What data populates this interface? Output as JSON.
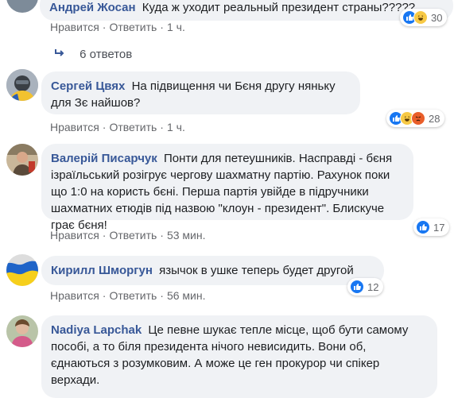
{
  "comments": [
    {
      "author": "Андрей Жосан",
      "text": "Куда ж уходит реальный президент страны?????",
      "like_label": "Нравится",
      "reply_label": "Ответить",
      "time": "1 ч.",
      "reaction_count": "30",
      "reactions": [
        "like-icon",
        "haha-icon"
      ]
    },
    {
      "author": "Сергей Цвях",
      "text": "На підвищення чи Бєня другу няньку для Зє найшов?",
      "like_label": "Нравится",
      "reply_label": "Ответить",
      "time": "1 ч.",
      "reaction_count": "28",
      "reactions": [
        "like-icon",
        "haha-icon",
        "angry-icon"
      ]
    },
    {
      "author": "Валерій Писарчук",
      "text": "Понти для петеушників. Насправді - бєня ізраїльський розігрує чергову шахматну партію. Рахунок поки що 1:0 на користь бєні. Перша партія увійде в підручники шахматних етюдів під назвою \"клоун - президент\". Блискуче грає бєня!",
      "like_label": "Нравится",
      "reply_label": "Ответить",
      "time": "53 мин.",
      "reaction_count": "17",
      "reactions": [
        "like-icon"
      ]
    },
    {
      "author": "Кирилл Шморгун",
      "text": "язычок в ушке теперь будет другой",
      "like_label": "Нравится",
      "reply_label": "Ответить",
      "time": "56 мин.",
      "reaction_count": "12",
      "reactions": [
        "like-icon"
      ]
    },
    {
      "author": "Nadiya Lapchak",
      "text": "Це певне шукає тепле місце, щоб бути самому пособі, а то біля президента нічого невисидить. Вони об, єднаються з розумковим. А може це ген прокурор чи спікер верхади.",
      "reactions": []
    }
  ],
  "replies_link": "6 ответов",
  "colors": {
    "author": "#385898",
    "bubble": "#f0f2f5",
    "meta": "#65676b",
    "like": "#1877f2"
  }
}
